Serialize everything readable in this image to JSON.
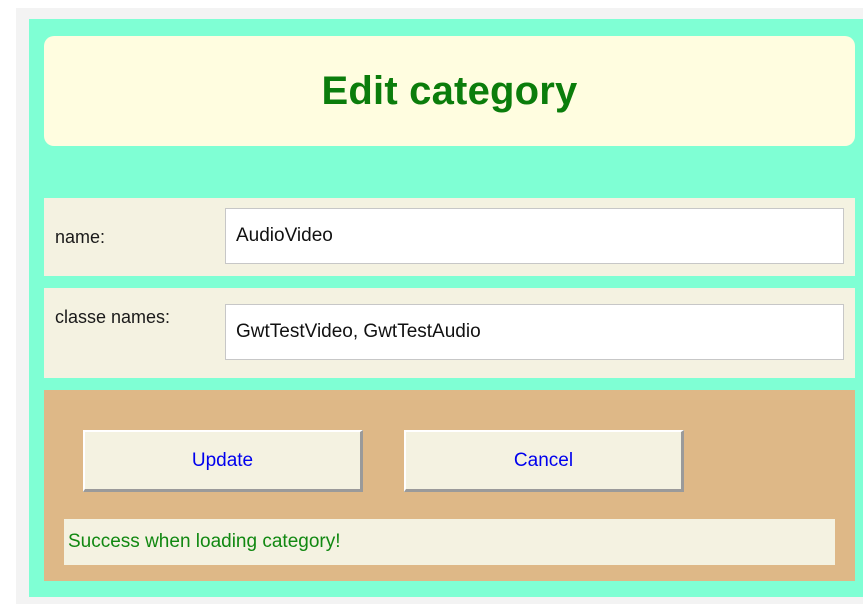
{
  "title": "Edit category",
  "form": {
    "name_label": "name:",
    "name_value": "AudioVideo",
    "classes_label": "classe names:",
    "classes_value": "GwtTestVideo, GwtTestAudio"
  },
  "actions": {
    "update_label": "Update",
    "cancel_label": "Cancel"
  },
  "status": {
    "message": "Success when loading category!"
  },
  "colors": {
    "panel_bg": "#7fffd4",
    "title_bg": "#fffde0",
    "title_text": "#0b7d0b",
    "row_bg": "#f4f2e1",
    "actions_bg": "#deb887",
    "link_blue": "#0000ee",
    "status_text": "#118811"
  }
}
